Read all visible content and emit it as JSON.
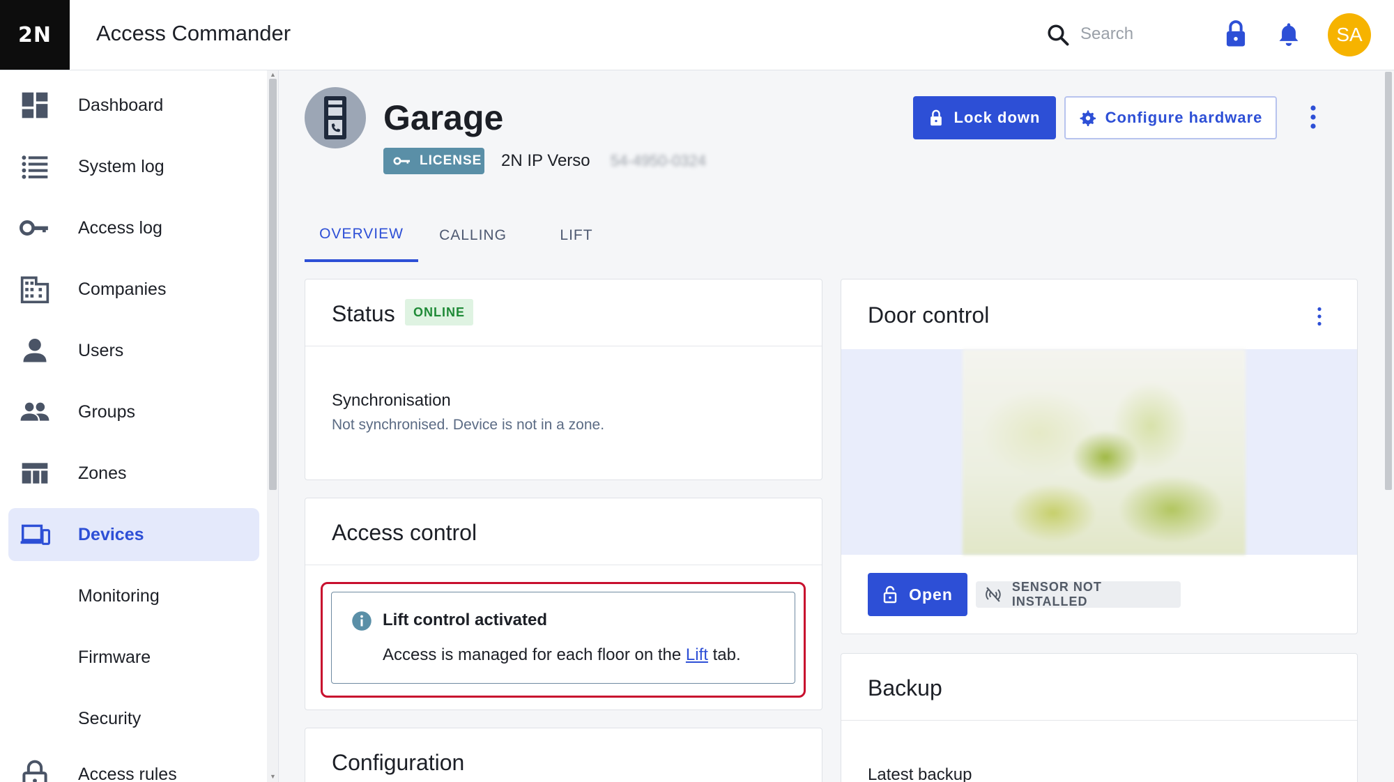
{
  "app": {
    "logo": "2N",
    "title": "Access Commander"
  },
  "header": {
    "search_placeholder": "Search",
    "avatar_initials": "SA"
  },
  "sidebar": {
    "items": [
      {
        "label": "Dashboard",
        "icon": "dashboard-icon"
      },
      {
        "label": "System log",
        "icon": "list-icon"
      },
      {
        "label": "Access log",
        "icon": "key-icon"
      },
      {
        "label": "Companies",
        "icon": "building-icon"
      },
      {
        "label": "Users",
        "icon": "user-icon"
      },
      {
        "label": "Groups",
        "icon": "group-icon"
      },
      {
        "label": "Zones",
        "icon": "zones-icon"
      },
      {
        "label": "Devices",
        "icon": "devices-icon",
        "active": true
      }
    ],
    "subitems": [
      {
        "label": "Monitoring"
      },
      {
        "label": "Firmware"
      },
      {
        "label": "Security"
      }
    ],
    "last_item": {
      "label": "Access rules",
      "icon": "lock-open-icon"
    }
  },
  "device": {
    "name": "Garage",
    "license_label": "LICENSE",
    "model": "2N IP Verso",
    "serial": "54-4950-0324"
  },
  "actions": {
    "lockdown_label": "Lock down",
    "configure_label": "Configure hardware"
  },
  "tabs": [
    {
      "label": "OVERVIEW",
      "active": true
    },
    {
      "label": "CALLING",
      "active": false
    },
    {
      "label": "LIFT",
      "active": false
    }
  ],
  "status_card": {
    "title": "Status",
    "badge": "ONLINE",
    "sync_label": "Synchronisation",
    "sync_value": "Not synchronised. Device is not in a zone."
  },
  "access_card": {
    "title": "Access control",
    "info_title": "Lift control activated",
    "info_text_before": "Access is managed for each floor on the ",
    "info_link": "Lift",
    "info_text_after": " tab."
  },
  "config_card": {
    "title": "Configuration"
  },
  "door_card": {
    "title": "Door control",
    "open_label": "Open",
    "sensor_label": "SENSOR NOT INSTALLED"
  },
  "backup_card": {
    "title": "Backup",
    "latest_label": "Latest backup"
  },
  "colors": {
    "accent": "#2d4fd6",
    "online": "#1f8a37",
    "license": "#5a8fa7",
    "highlight": "#c8102e",
    "avatar": "#f6b300"
  }
}
